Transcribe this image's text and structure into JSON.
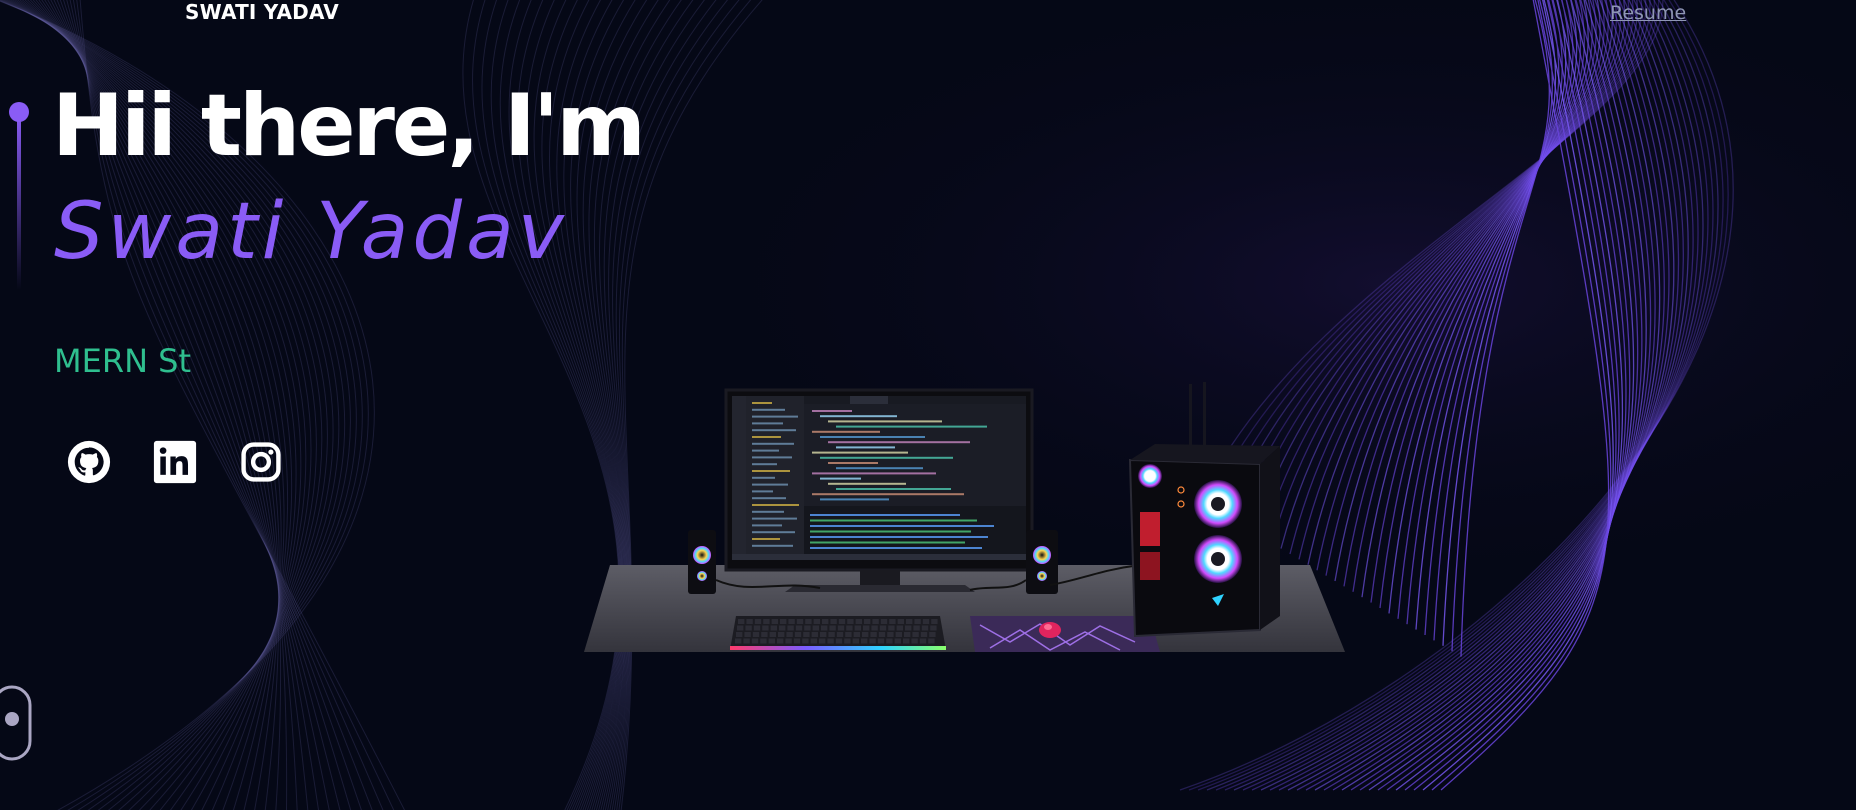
{
  "nav": {
    "brand": "SWATI YADAV",
    "resume_label": "Resume"
  },
  "hero": {
    "greeting": "Hii there, I'm",
    "name": "Swati Yadav",
    "typing_text": "MERN St"
  },
  "social": [
    {
      "icon": "github-icon"
    },
    {
      "icon": "linkedin-icon"
    },
    {
      "icon": "instagram-icon"
    }
  ],
  "colors": {
    "background": "#050816",
    "accent_purple": "#8a5cf6",
    "accent_green": "#2fbf8f",
    "text_white": "#ffffff",
    "link_muted": "#8f96b5"
  }
}
